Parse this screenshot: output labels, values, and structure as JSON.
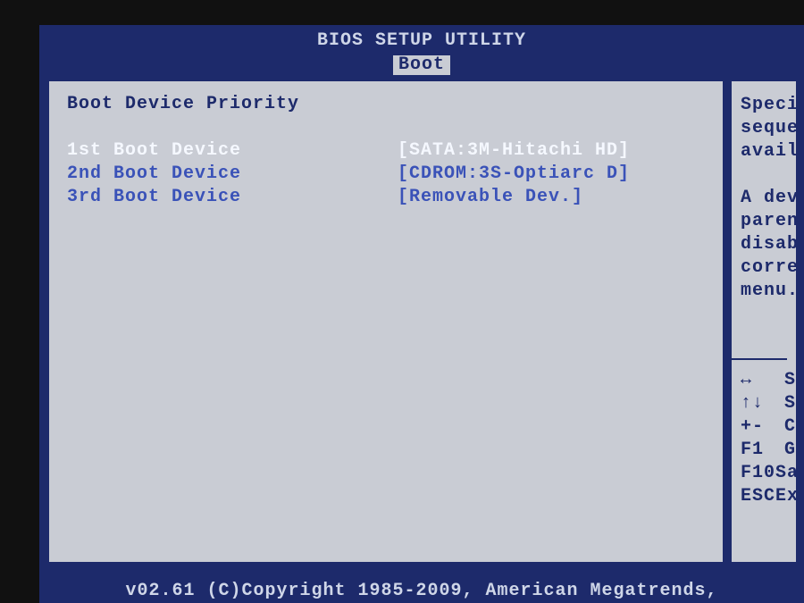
{
  "colors": {
    "blue": "#1d2a6b",
    "panel": "#c9ccd4",
    "light_text": "#cfd6e8",
    "highlight_text": "#f5f8ff",
    "link_blue": "#3a52b8"
  },
  "title": "BIOS SETUP UTILITY",
  "tabs": {
    "active": "Boot"
  },
  "main": {
    "heading": "Boot Device Priority",
    "items": [
      {
        "label": "1st Boot Device",
        "value": "[SATA:3M-Hitachi HD]",
        "selected": true
      },
      {
        "label": "2nd Boot Device",
        "value": "[CDROM:3S-Optiarc D]",
        "selected": false
      },
      {
        "label": "3rd Boot Device",
        "value": "[Removable Dev.]",
        "selected": false
      }
    ]
  },
  "side": {
    "help_lines": [
      "Speci",
      "seque",
      "avail",
      "",
      "A dev",
      "parent",
      "disabl",
      "corres",
      "menu."
    ],
    "keys": [
      {
        "key": "↔",
        "desc": "S"
      },
      {
        "key": "↑↓",
        "desc": "S"
      },
      {
        "key": "+-",
        "desc": "C"
      },
      {
        "key": "F1",
        "desc": "G"
      },
      {
        "key": "F10",
        "desc": "Sa"
      },
      {
        "key": "ESC",
        "desc": "Ex"
      }
    ]
  },
  "footer": "v02.61 (C)Copyright 1985-2009, American Megatrends,"
}
